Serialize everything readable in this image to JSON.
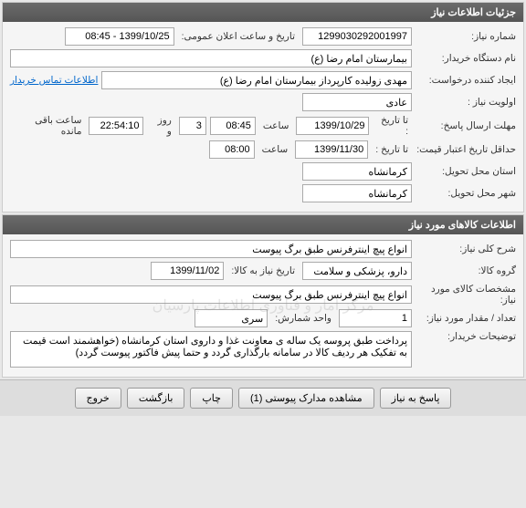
{
  "panels": {
    "need_info": {
      "title": "جزئیات اطلاعات نیاز",
      "fields": {
        "need_number_label": "شماره نیاز:",
        "need_number": "1299030292001997",
        "public_announce_label": "تاریخ و ساعت اعلان عمومی:",
        "public_announce": "1399/10/25 - 08:45",
        "device_name_label": "نام دستگاه خریدار:",
        "device_name": "بیمارستان امام رضا (ع)",
        "creator_label": "ایجاد کننده درخواست:",
        "creator": "مهدی زولیده کارپرداز بیمارستان امام رضا (ع)",
        "contact_link": "اطلاعات تماس خریدار",
        "priority_label": "اولویت نیاز :",
        "priority": "عادی",
        "deadline_label": "مهلت ارسال پاسخ:",
        "to_date_label": "تا تاریخ :",
        "to_date": "1399/10/29",
        "time_label": "ساعت",
        "to_time": "08:45",
        "days_count": "3",
        "days_label": "روز و",
        "remaining_time": "22:54:10",
        "remaining_label": "ساعت باقی مانده",
        "min_validity_label": "حداقل تاریخ اعتبار قیمت:",
        "validity_to_label": "تا تاریخ :",
        "validity_date": "1399/11/30",
        "validity_time": "08:00",
        "delivery_province_label": "استان محل تحویل:",
        "delivery_province": "کرمانشاه",
        "delivery_city_label": "شهر محل تحویل:",
        "delivery_city": "کرمانشاه"
      }
    },
    "goods_info": {
      "title": "اطلاعات کالاهای مورد نیاز",
      "fields": {
        "general_desc_label": "شرح کلی نیاز:",
        "general_desc": "انواع پیچ اینترفرنس طبق برگ پیوست",
        "group_label": "گروه کالا:",
        "group": "دارو، پزشکی و سلامت",
        "goods_date_label": "تاریخ نیاز به کالا:",
        "goods_date": "1399/11/02",
        "spec_label": "مشخصات کالای مورد نیاز:",
        "spec": "انواع پیچ اینترفرنس طبق برگ پیوست",
        "quantity_label": "تعداد / مقدار مورد نیاز:",
        "quantity": "1",
        "unit_label": "واحد شمارش:",
        "unit": "سری",
        "buyer_desc_label": "توضیحات خریدار:",
        "buyer_desc": "پرداخت طبق پروسه یک ساله ی معاونت غذا و داروی استان کرمانشاه (خواهشمند است قیمت به تفکیک هر ردیف کالا در سامانه بارگذاری گردد و حتما پیش فاکتور پیوست گردد)"
      }
    }
  },
  "footer": {
    "respond": "پاسخ به نیاز",
    "attachments": "مشاهده مدارک پیوستی (1)",
    "print": "چاپ",
    "back": "بازگشت",
    "exit": "خروج"
  },
  "watermark": "مرکز آمار و فناوری اطلاعات پارسیان"
}
